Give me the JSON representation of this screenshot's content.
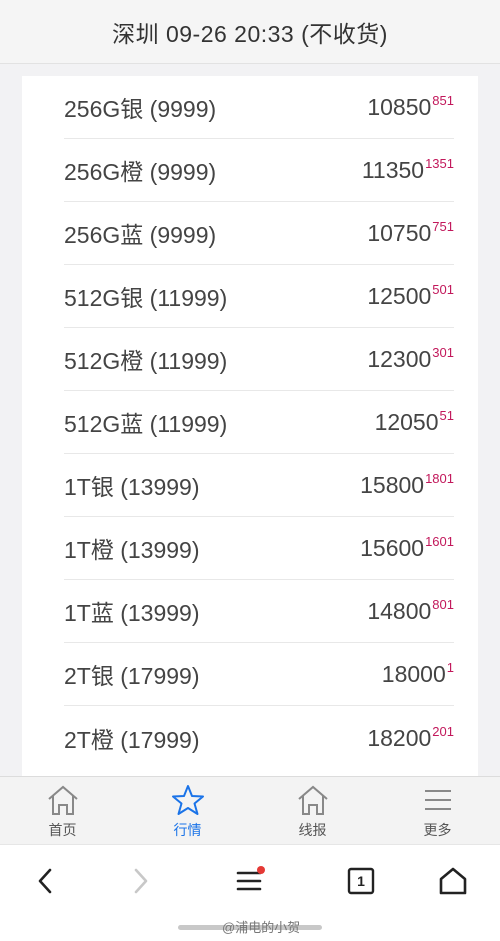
{
  "header": {
    "title": "深圳 09-26 20:33 (不收货)"
  },
  "rows": [
    {
      "label": "256G银 (9999)",
      "price": "10850",
      "diff": "851"
    },
    {
      "label": "256G橙 (9999)",
      "price": "11350",
      "diff": "1351"
    },
    {
      "label": "256G蓝 (9999)",
      "price": "10750",
      "diff": "751"
    },
    {
      "label": "512G银 (11999)",
      "price": "12500",
      "diff": "501"
    },
    {
      "label": "512G橙 (11999)",
      "price": "12300",
      "diff": "301"
    },
    {
      "label": "512G蓝 (11999)",
      "price": "12050",
      "diff": "51"
    },
    {
      "label": "1T银 (13999)",
      "price": "15800",
      "diff": "1801"
    },
    {
      "label": "1T橙 (13999)",
      "price": "15600",
      "diff": "1601"
    },
    {
      "label": "1T蓝 (13999)",
      "price": "14800",
      "diff": "801"
    },
    {
      "label": "2T银 (17999)",
      "price": "18000",
      "diff": "1"
    },
    {
      "label": "2T橙 (17999)",
      "price": "18200",
      "diff": "201"
    }
  ],
  "tabbar": {
    "tabs": [
      {
        "label": "首页",
        "icon": "home-icon"
      },
      {
        "label": "行情",
        "icon": "star-icon",
        "active": true
      },
      {
        "label": "线报",
        "icon": "home-icon"
      },
      {
        "label": "更多",
        "icon": "menu-icon"
      }
    ]
  },
  "browser": {
    "tab_count": "1",
    "icons": [
      "back-icon",
      "forward-icon",
      "menu-icon",
      "tabs-icon",
      "home-icon"
    ]
  },
  "watermark": "@浦电的小贺",
  "colors": {
    "accent": "#1a73e8",
    "diff": "#c2185b",
    "notification": "#e53935"
  }
}
